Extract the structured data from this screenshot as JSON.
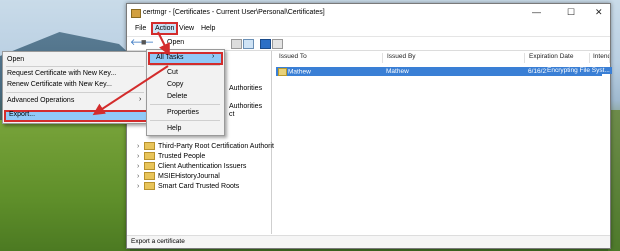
{
  "window": {
    "title": "certmgr - [Certificates - Current User\\Personal\\Certificates]"
  },
  "controls": {
    "minimize": "—",
    "maximize": "☐",
    "close": "✕"
  },
  "menubar": {
    "file": "File",
    "action": "Action",
    "view": "View",
    "help": "Help"
  },
  "action_menu_partial": "Open",
  "tree": [
    "Authorities",
    "Authorities",
    "ct",
    "Third-Party Root Certification Authorities",
    "Trusted People",
    "Client Authentication Issuers",
    "MSIEHistoryJournal",
    "Smart Card Trusted Roots"
  ],
  "columns": [
    "Issued To",
    "Issued By",
    "Expiration Date",
    "Intended Purposes"
  ],
  "cert_row": {
    "issued_to": "Mathew",
    "issued_by": "Mathew",
    "expiration": "6/16/2117",
    "purposes": "Encrypting File Syst..."
  },
  "statusbar": "Export a certificate",
  "action_menu": {
    "all_tasks": "All Tasks",
    "cut": "Cut",
    "copy": "Copy",
    "delete": "Delete",
    "properties": "Properties",
    "help": "Help"
  },
  "submenu": {
    "open": "Open",
    "request": "Request Certificate with New Key...",
    "renew": "Renew Certificate with New Key...",
    "advanced": "Advanced Operations",
    "export": "Export..."
  },
  "colors": {
    "highlight": "#91c9f7",
    "annotation": "#d32c2c",
    "selection": "#3a7fd5"
  }
}
